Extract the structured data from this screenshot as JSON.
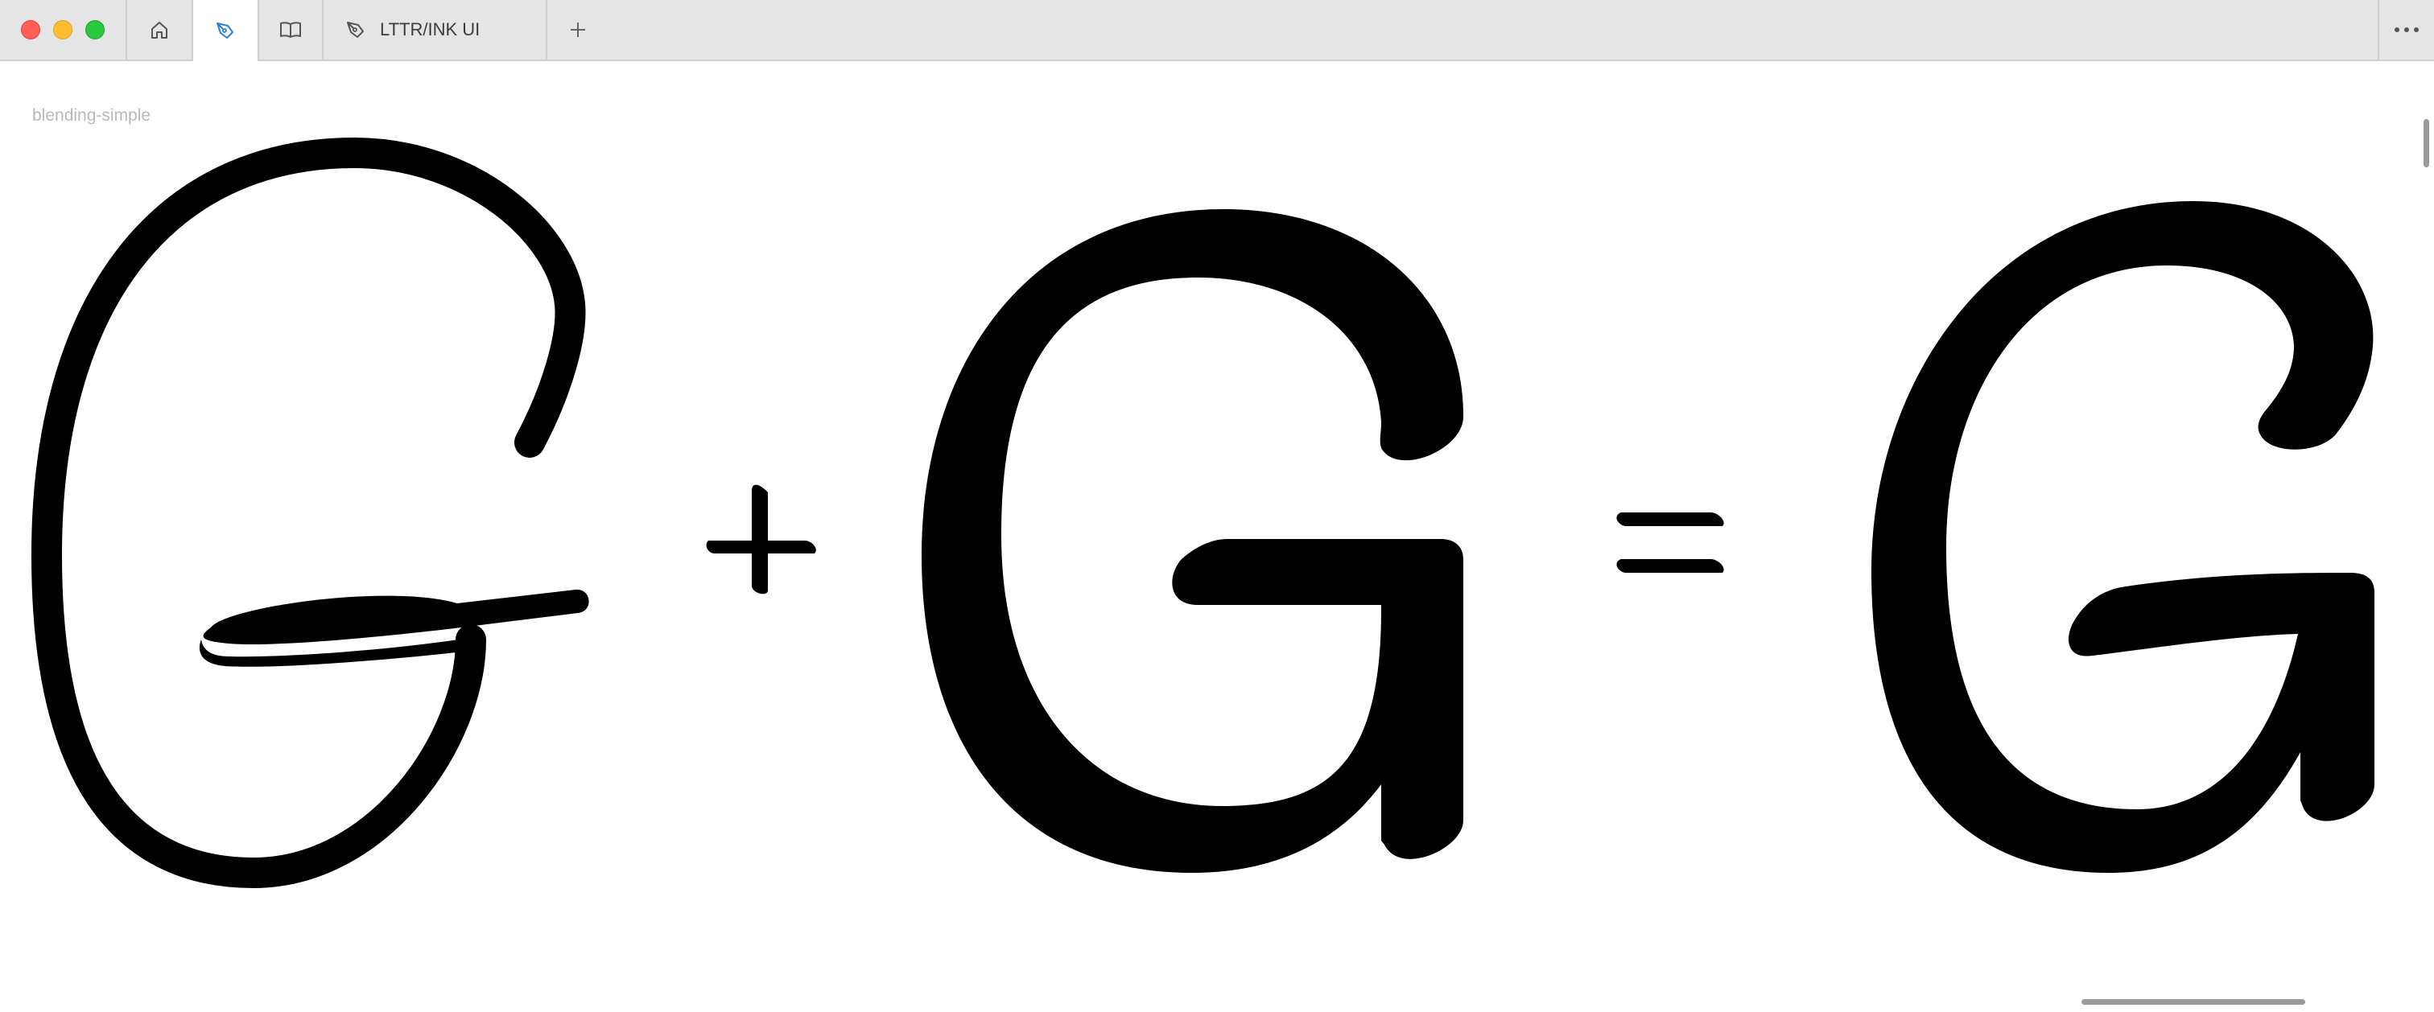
{
  "window": {
    "tabs": [
      {
        "icon": "home-icon"
      },
      {
        "icon": "pen-nib-icon",
        "active": true
      },
      {
        "icon": "book-icon"
      },
      {
        "icon": "pen-nib-icon",
        "label": "LTTR/INK UI"
      }
    ],
    "new_tab_icon": "plus-icon",
    "more_icon": "ellipsis-icon"
  },
  "document": {
    "label": "blending-simple"
  },
  "colors": {
    "accent": "#2f7fd6",
    "glyph": "#000000",
    "tabbar": "#e5e5e5"
  }
}
